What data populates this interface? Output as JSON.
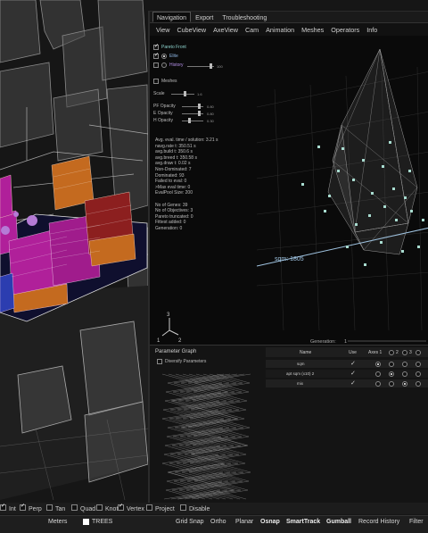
{
  "plugin": {
    "tabs": [
      "Navigation",
      "Export",
      "Troubleshooting"
    ],
    "menu": [
      "View",
      "CubeView",
      "AxeView",
      "Cam",
      "Animation",
      "Meshes",
      "Operators",
      "Info"
    ],
    "options": {
      "pareto_front": "Pareto Front",
      "elite": "Elite",
      "history": "History",
      "history_value": "100",
      "meshes": "Meshes",
      "scale": "Scale",
      "scale_value": "1.6",
      "pf_opacity": "PF Opacity",
      "pf_value": "0.80",
      "e_opacity": "E Opacity",
      "e_value": "0.80",
      "h_opacity": "H Opacity",
      "h_value": "0.30"
    },
    "stats": [
      "Avg. eval. time / solution: 3.21 s",
      "navg.rate t: 350.51 s",
      "avg.build t: 350.6 s",
      "avg.breed t: 350.58 s",
      "avg.draw t: 0.02 s",
      "Non-Dominated: 7",
      "Dominated: 93",
      "Failed to eval: 0",
      ">Max eval time: 0",
      "EvalPool Size: 200",
      "",
      "No of Genes: 39",
      "No of Objectives: 3",
      "Pareto truncated: 0",
      "Fittest added: 0",
      "Generation: 0"
    ],
    "axis_label": "sqm: 1805",
    "generation_label": "Generation:",
    "generation_value": "1",
    "gizmo": {
      "x": "1",
      "y": "2",
      "z": "3"
    }
  },
  "param_graph": {
    "title": "Parameter Graph",
    "diversify": "Diversify Parameters",
    "headers": {
      "name": "Name",
      "use": "Use",
      "axes": "Axes 1",
      "a2": "2",
      "a3": "3"
    },
    "rows": [
      {
        "name": "sqm",
        "use": "✓"
      },
      {
        "name": "apt sqm (x10) 2",
        "use": "✓"
      },
      {
        "name": "mix",
        "use": "✓"
      }
    ]
  },
  "snapbar": {
    "items": [
      "Int",
      "Perp",
      "Tan",
      "Quad",
      "Knot",
      "Vertex",
      "Project",
      "Disable"
    ]
  },
  "statusbar": {
    "units": "Meters",
    "layer": "TREES",
    "items": [
      "Grid Snap",
      "Ortho",
      "Planar",
      "Osnap",
      "SmartTrack",
      "Gumball",
      "Record History",
      "Filter"
    ]
  },
  "colors": {
    "points": "#a8dcd0",
    "magenta": "#b0209a",
    "orange": "#c46a1f",
    "red": "#8c1f1f",
    "blue": "#2c3db0"
  }
}
